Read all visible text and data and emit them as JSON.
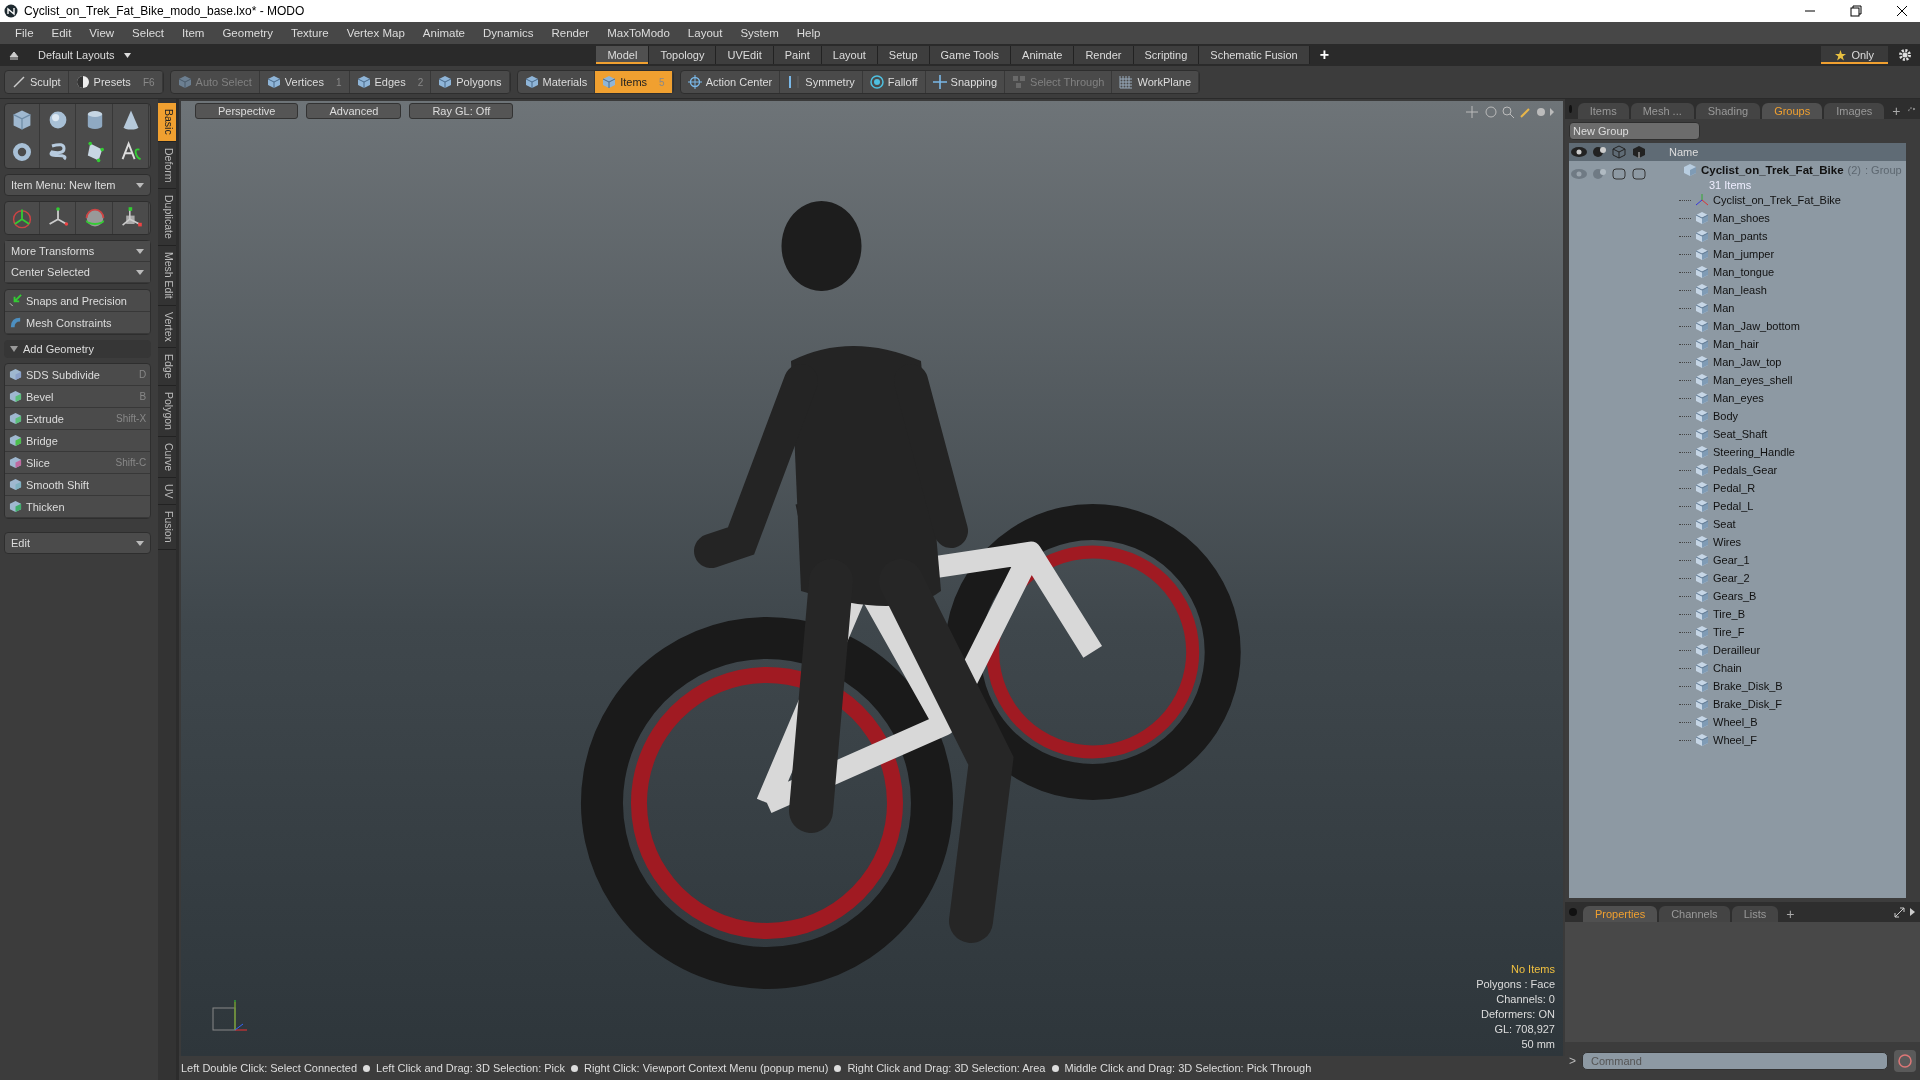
{
  "window": {
    "title": "Cyclist_on_Trek_Fat_Bike_modo_base.lxo* - MODO"
  },
  "menu": [
    "File",
    "Edit",
    "View",
    "Select",
    "Item",
    "Geometry",
    "Texture",
    "Vertex Map",
    "Animate",
    "Dynamics",
    "Render",
    "MaxToModo",
    "Layout",
    "System",
    "Help"
  ],
  "layout_bar": {
    "layouts": "Default Layouts",
    "tabs": [
      {
        "label": "Model",
        "selected": true
      },
      {
        "label": "Topology",
        "selected": false
      },
      {
        "label": "UVEdit",
        "selected": false
      },
      {
        "label": "Paint",
        "selected": false
      },
      {
        "label": "Layout",
        "selected": false
      },
      {
        "label": "Setup",
        "selected": false
      },
      {
        "label": "Game Tools",
        "selected": false
      },
      {
        "label": "Animate",
        "selected": false
      },
      {
        "label": "Render",
        "selected": false
      },
      {
        "label": "Scripting",
        "selected": false
      },
      {
        "label": "Schematic Fusion",
        "selected": false
      }
    ],
    "add": "+",
    "only": "Only"
  },
  "toolbar": [
    [
      {
        "kind": "sculpt",
        "label": "Sculpt",
        "disabled": false,
        "selected": false
      },
      {
        "kind": "presets",
        "label": "Presets",
        "shortcut": "F6",
        "disabled": false,
        "selected": false
      }
    ],
    [
      {
        "kind": "cube",
        "label": "Auto Select",
        "disabled": true,
        "selected": false
      },
      {
        "kind": "cube",
        "label": "Vertices",
        "shortcut": "1",
        "disabled": false,
        "selected": false
      },
      {
        "kind": "cube",
        "label": "Edges",
        "shortcut": "2",
        "disabled": false,
        "selected": false
      },
      {
        "kind": "cube",
        "label": "Polygons",
        "disabled": false,
        "selected": false
      }
    ],
    [
      {
        "kind": "cube",
        "label": "Materials",
        "disabled": false,
        "selected": false
      },
      {
        "kind": "cube",
        "label": "Items",
        "shortcut": "5",
        "disabled": false,
        "selected": true
      }
    ],
    [
      {
        "kind": "target",
        "label": "Action Center",
        "disabled": false,
        "selected": false
      },
      {
        "kind": "mirror",
        "label": "Symmetry",
        "disabled": false,
        "selected": false
      },
      {
        "kind": "ring",
        "label": "Falloff",
        "disabled": false,
        "selected": false
      },
      {
        "kind": "cross",
        "label": "Snapping",
        "disabled": false,
        "selected": false
      },
      {
        "kind": "cluster",
        "label": "Select Through",
        "disabled": true,
        "selected": false
      },
      {
        "kind": "grid",
        "label": "WorkPlane",
        "disabled": false,
        "selected": false
      }
    ]
  ],
  "left_panel": {
    "item_menu": "Item Menu: New Item",
    "transform_menus": [
      "More Transforms",
      "Center Selected"
    ],
    "tools": [
      {
        "kind": "snap",
        "label": "Snaps and Precision"
      },
      {
        "kind": "constraint",
        "label": "Mesh Constraints"
      }
    ],
    "section": {
      "label": "Add Geometry",
      "expanded": true,
      "tools": [
        {
          "kind": "sds",
          "label": "SDS Subdivide",
          "shortcut": "D"
        },
        {
          "kind": "bevel",
          "label": "Bevel",
          "shortcut": "B"
        },
        {
          "kind": "bevel",
          "label": "Extrude",
          "shortcut": "Shift-X"
        },
        {
          "kind": "bridge",
          "label": "Bridge"
        },
        {
          "kind": "slice",
          "label": "Slice",
          "shortcut": "Shift-C"
        },
        {
          "kind": "shift",
          "label": "Smooth Shift"
        },
        {
          "kind": "thicken",
          "label": "Thicken"
        }
      ]
    },
    "edit_menu": "Edit",
    "side_tabs": [
      {
        "label": "Basic",
        "selected": true
      },
      {
        "label": "Deform",
        "selected": false
      },
      {
        "label": "Duplicate",
        "selected": false
      },
      {
        "label": "Mesh Edit",
        "selected": false
      },
      {
        "label": "Vertex",
        "selected": false
      },
      {
        "label": "Edge",
        "selected": false
      },
      {
        "label": "Polygon",
        "selected": false
      },
      {
        "label": "Curve",
        "selected": false
      },
      {
        "label": "UV",
        "selected": false
      },
      {
        "label": "Fusion",
        "selected": false
      }
    ]
  },
  "viewport": {
    "buttons": [
      "Perspective",
      "Advanced",
      "Ray GL: Off"
    ],
    "info_title": "No Items",
    "info": [
      "Polygons : Face",
      "Channels: 0",
      "Deformers: ON",
      "GL: 708,927",
      "50 mm"
    ]
  },
  "right_panel": {
    "tabs": [
      {
        "label": "Items",
        "selected": false
      },
      {
        "label": "Mesh ...",
        "selected": false
      },
      {
        "label": "Shading",
        "selected": false
      },
      {
        "label": "Groups",
        "selected": true
      },
      {
        "label": "Images",
        "selected": false
      }
    ],
    "add": "+",
    "new_group": "New Group",
    "column": "Name",
    "tree": {
      "name": "Cyclist_on_Trek_Fat_Bike",
      "count": "(2)",
      "type": ": Group",
      "subtitle": "31 Items",
      "expanded": true,
      "children": [
        {
          "kind": "locator",
          "name": "Cyclist_on_Trek_Fat_Bike"
        },
        {
          "kind": "mesh",
          "name": "Man_shoes"
        },
        {
          "kind": "mesh",
          "name": "Man_pants"
        },
        {
          "kind": "mesh",
          "name": "Man_jumper"
        },
        {
          "kind": "mesh",
          "name": "Man_tongue"
        },
        {
          "kind": "mesh",
          "name": "Man_leash"
        },
        {
          "kind": "mesh",
          "name": "Man"
        },
        {
          "kind": "mesh",
          "name": "Man_Jaw_bottom"
        },
        {
          "kind": "mesh",
          "name": "Man_hair"
        },
        {
          "kind": "mesh",
          "name": "Man_Jaw_top"
        },
        {
          "kind": "mesh",
          "name": "Man_eyes_shell"
        },
        {
          "kind": "mesh",
          "name": "Man_eyes"
        },
        {
          "kind": "mesh",
          "name": "Body"
        },
        {
          "kind": "mesh",
          "name": "Seat_Shaft"
        },
        {
          "kind": "mesh",
          "name": "Steering_Handle"
        },
        {
          "kind": "mesh",
          "name": "Pedals_Gear"
        },
        {
          "kind": "mesh",
          "name": "Pedal_R"
        },
        {
          "kind": "mesh",
          "name": "Pedal_L"
        },
        {
          "kind": "mesh",
          "name": "Seat"
        },
        {
          "kind": "mesh",
          "name": "Wires"
        },
        {
          "kind": "mesh",
          "name": "Gear_1"
        },
        {
          "kind": "mesh",
          "name": "Gear_2"
        },
        {
          "kind": "mesh",
          "name": "Gears_B"
        },
        {
          "kind": "mesh",
          "name": "Tire_B"
        },
        {
          "kind": "mesh",
          "name": "Tire_F"
        },
        {
          "kind": "mesh",
          "name": "Derailleur"
        },
        {
          "kind": "mesh",
          "name": "Chain"
        },
        {
          "kind": "mesh",
          "name": "Brake_Disk_B"
        },
        {
          "kind": "mesh",
          "name": "Brake_Disk_F"
        },
        {
          "kind": "mesh",
          "name": "Wheel_B"
        },
        {
          "kind": "mesh",
          "name": "Wheel_F"
        }
      ]
    },
    "bottom_tabs": [
      {
        "label": "Properties",
        "selected": true
      },
      {
        "label": "Channels",
        "selected": false
      },
      {
        "label": "Lists",
        "selected": false
      }
    ],
    "bottom_add": "+",
    "prompt": ">",
    "command_placeholder": "Command"
  },
  "status_bar": [
    "Left Double Click: Select Connected",
    "Left Click and Drag: 3D Selection: Pick",
    "Right Click: Viewport Context Menu (popup menu)",
    "Right Click and Drag: 3D Selection: Area",
    "Middle Click and Drag: 3D Selection: Pick Through"
  ]
}
